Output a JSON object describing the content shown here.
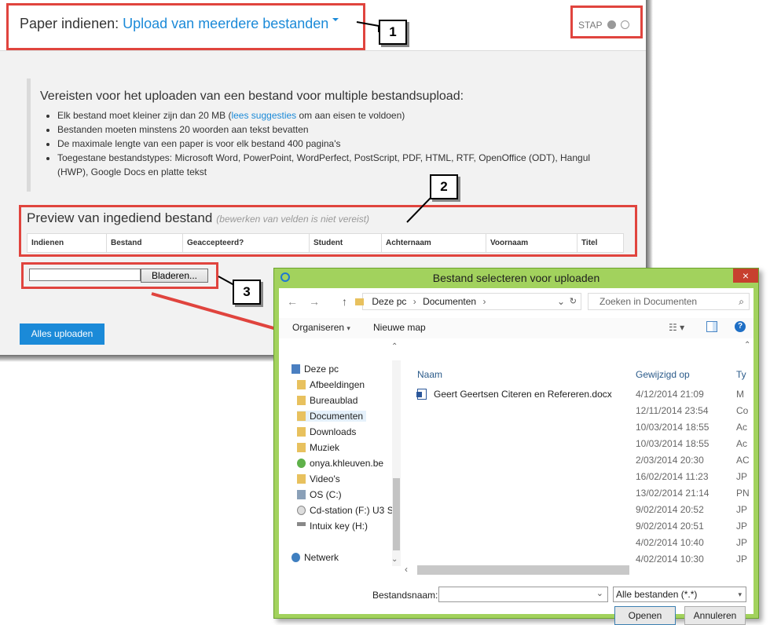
{
  "header": {
    "prefix": "Paper indienen:",
    "mode_link": "Upload van meerdere bestanden",
    "step_label": "STAP"
  },
  "requirements": {
    "title": "Vereisten voor het uploaden van een bestand voor multiple bestandsupload:",
    "item1_before": "Elk bestand moet kleiner zijn dan 20 MB (",
    "item1_link": "lees suggesties",
    "item1_after": " om aan eisen te voldoen)",
    "item2": "Bestanden moeten minstens 20 woorden aan tekst bevatten",
    "item3": "De maximale lengte van een paper is voor elk bestand 400 pagina's",
    "item4": "Toegestane bestandstypes: Microsoft Word, PowerPoint, WordPerfect, PostScript, PDF, HTML, RTF, OpenOffice (ODT), Hangul (HWP), Google Docs en platte tekst"
  },
  "preview": {
    "title": "Preview van ingediend bestand",
    "subtitle": "(bewerken van velden is niet vereist)",
    "columns": [
      "Indienen",
      "Bestand",
      "Geaccepteerd?",
      "Student",
      "Achternaam",
      "Voornaam",
      "Titel"
    ]
  },
  "browse_label": "Bladeren...",
  "upload_all_label": "Alles uploaden",
  "callouts": [
    "1",
    "2",
    "3"
  ],
  "dialog": {
    "title": "Bestand selecteren voor uploaden",
    "close": "×",
    "breadcrumb": [
      "Deze pc",
      "Documenten"
    ],
    "search_placeholder": "Zoeken in Documenten",
    "organize": "Organiseren",
    "new_folder": "Nieuwe map",
    "tree": [
      "Deze pc",
      "Afbeeldingen",
      "Bureaublad",
      "Documenten",
      "Downloads",
      "Muziek",
      "onya.khleuven.be",
      "Video's",
      "OS (C:)",
      "Cd-station (F:) U3 S",
      "Intuix key (H:)",
      "Netwerk"
    ],
    "col_name": "Naam",
    "col_modified": "Gewijzigd op",
    "col_type": "Ty",
    "file_name": "Geert Geertsen Citeren en Refereren.docx",
    "dates": [
      "4/12/2014 21:09",
      "12/11/2014 23:54",
      "10/03/2014 18:55",
      "10/03/2014 18:55",
      "2/03/2014 20:30",
      "16/02/2014 11:23",
      "13/02/2014 21:14",
      "9/02/2014 20:52",
      "9/02/2014 20:51",
      "4/02/2014 10:40",
      "4/02/2014 10:30"
    ],
    "types": [
      "M",
      "Co",
      "Ac",
      "Ac",
      "AC",
      "JP",
      "PN",
      "JP",
      "JP",
      "JP",
      "JP"
    ],
    "filename_label": "Bestandsnaam:",
    "filter_value": "Alle bestanden (*.*)",
    "open_label": "Openen",
    "cancel_label": "Annuleren"
  },
  "colors": {
    "accent": "#1b8ad8",
    "callout_red": "#e0443e",
    "dialog_frame": "#a2d25d"
  }
}
